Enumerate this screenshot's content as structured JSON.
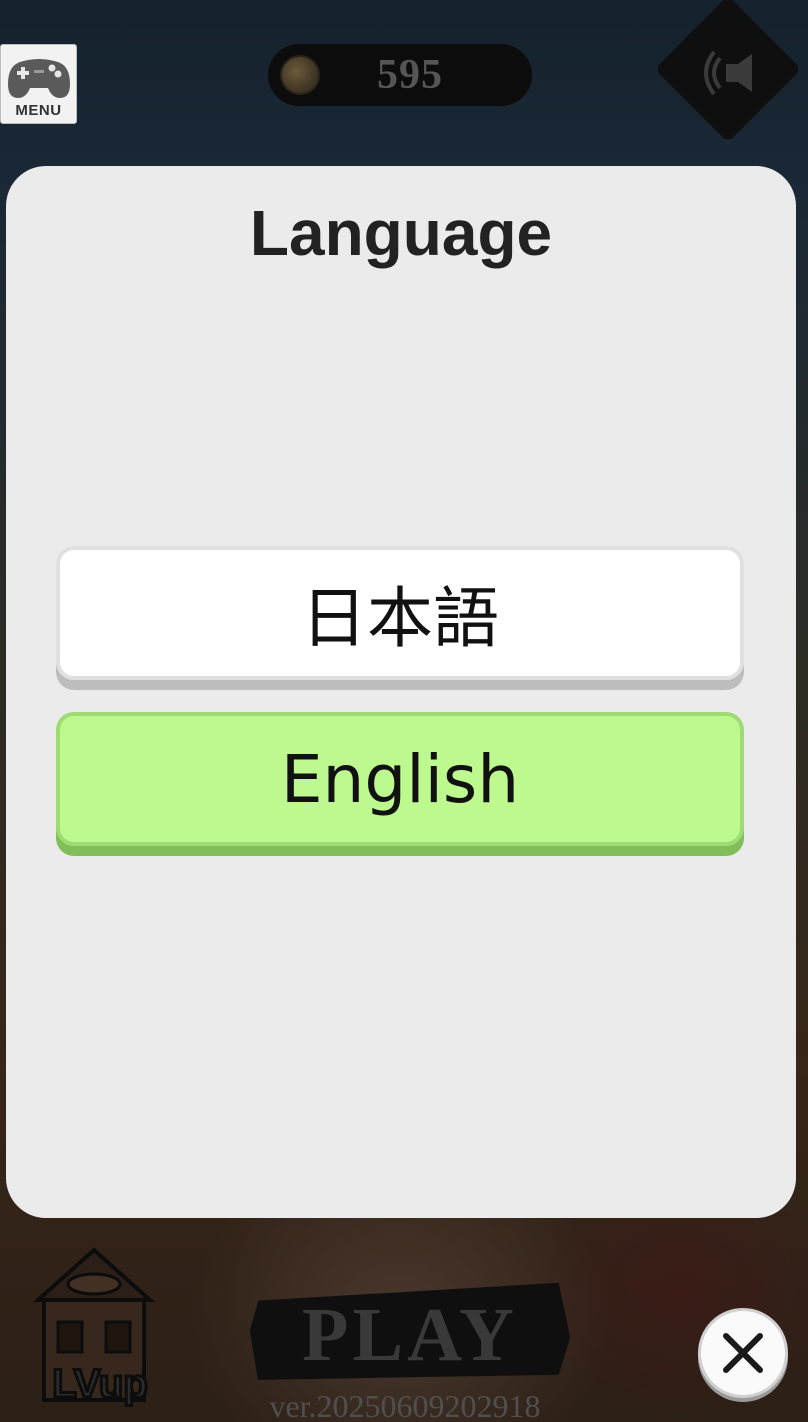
{
  "hud": {
    "menu_label": "MENU",
    "coins": "595",
    "sound_icon": "speaker-icon"
  },
  "dialog": {
    "title": "Language",
    "options": [
      {
        "label": "日本語",
        "selected": false
      },
      {
        "label": "English",
        "selected": true
      }
    ],
    "selected_color": "#bdf98e"
  },
  "background": {
    "lvup_label": "LVup",
    "play_label": "PLAY",
    "version": "ver.20250609202918"
  },
  "close_icon": "close-icon"
}
